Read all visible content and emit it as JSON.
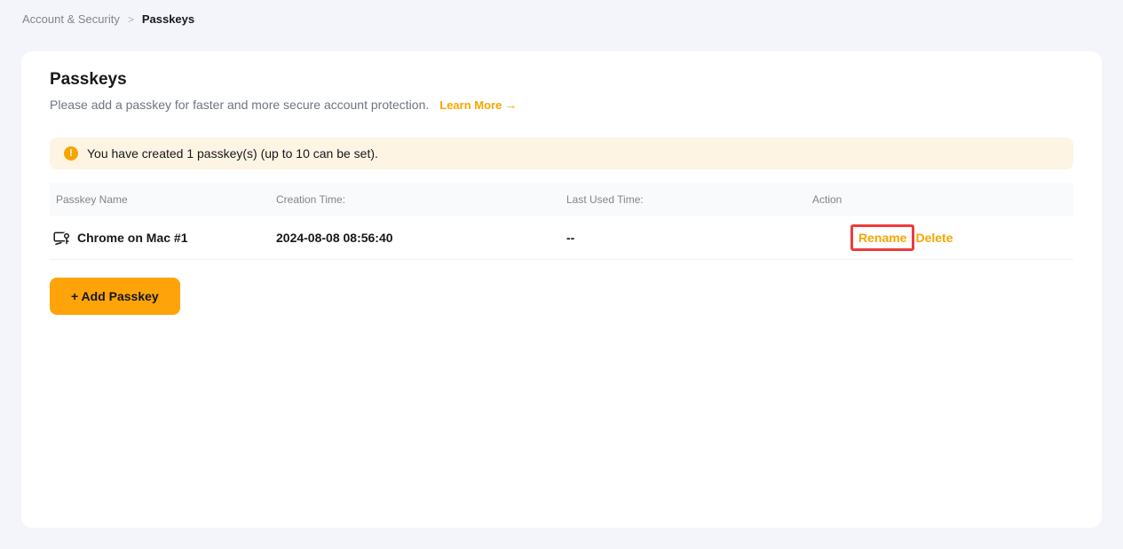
{
  "breadcrumb": {
    "parent": "Account & Security",
    "separator": ">",
    "current": "Passkeys"
  },
  "card": {
    "title": "Passkeys",
    "subtitle": "Please add a passkey for faster and more secure account protection.",
    "learn_more": {
      "label": "Learn More",
      "arrow": "→"
    },
    "banner": {
      "icon": "exclamation-circle",
      "icon_glyph": "!",
      "text": "You have created 1 passkey(s) (up to 10 can be set)."
    },
    "table": {
      "headers": [
        "Passkey Name",
        "Creation Time:",
        "Last Used Time:",
        "Action"
      ],
      "rows": [
        {
          "icon": "device-monitor-key",
          "name": "Chrome on Mac #1",
          "creation_time": "2024-08-08 08:56:40",
          "last_used": "--",
          "actions": [
            {
              "label": "Rename",
              "highlighted": true
            },
            {
              "label": "Delete",
              "highlighted": false
            }
          ]
        }
      ]
    },
    "add_button": {
      "label": "+ Add Passkey"
    }
  },
  "colors": {
    "accent_orange": "#F7A600",
    "button_orange": "#FEA40A",
    "annotation_red": "#EE3B3B",
    "banner_background": "#FDF4E3",
    "table_header_background": "#F9FAFB",
    "page_background": "#F4F5FA",
    "card_background": "#FFFFFF",
    "text_dark": "#17181A",
    "text_gray": "#81858C"
  }
}
